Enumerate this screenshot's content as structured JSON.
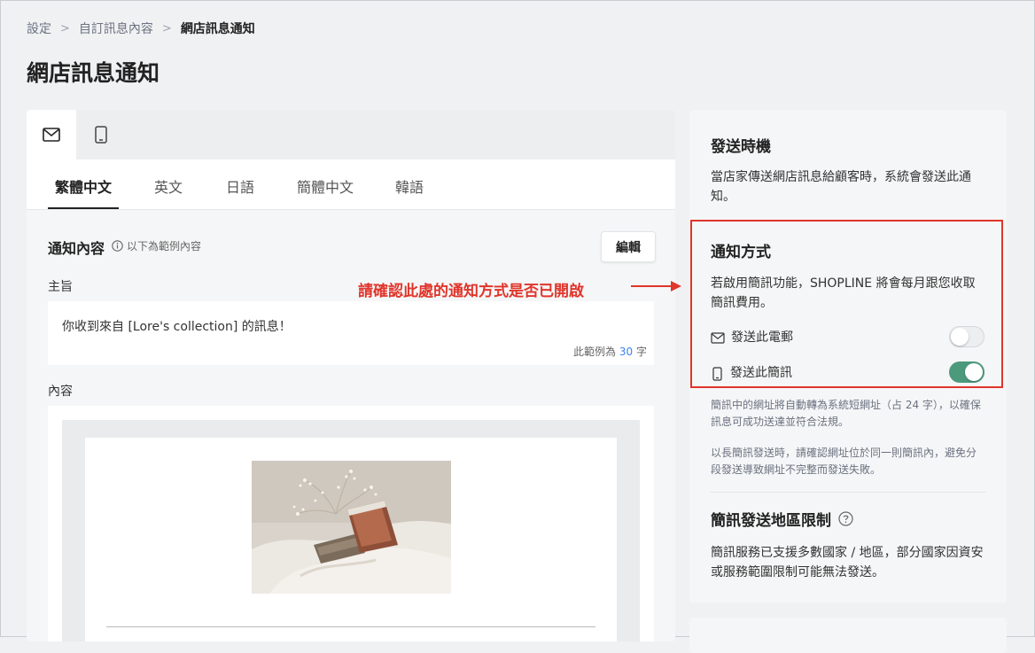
{
  "breadcrumb": {
    "items": [
      "設定",
      "自訂訊息內容"
    ],
    "current": "網店訊息通知"
  },
  "page_title": "網店訊息通知",
  "channel_tabs": [
    {
      "icon": "mail-icon",
      "active": true
    },
    {
      "icon": "mobile-icon",
      "active": false
    }
  ],
  "language_tabs": [
    {
      "label": "繁體中文",
      "active": true
    },
    {
      "label": "英文",
      "active": false
    },
    {
      "label": "日語",
      "active": false
    },
    {
      "label": "簡體中文",
      "active": false
    },
    {
      "label": "韓語",
      "active": false
    }
  ],
  "notification_content": {
    "title": "通知內容",
    "hint": "以下為範例內容",
    "edit_label": "編輯",
    "subject_label": "主旨",
    "subject_text": "你收到來自 [Lore's collection] 的訊息！",
    "char_count_prefix": "此範例為",
    "char_count_value": "30",
    "char_count_suffix": "字",
    "body_label": "內容"
  },
  "annotation": {
    "text": "請確認此處的通知方式是否已開啟",
    "color": "#e0352b"
  },
  "send_timing": {
    "title": "發送時機",
    "description_line1": "當店家傳送網店訊息給顧客時，系統會發送此通",
    "description_line2": "知。"
  },
  "notification_method": {
    "title": "通知方式",
    "description_line1": "若啟用簡訊功能，SHOPLINE 將會每月跟您收取",
    "description_line2": "簡訊費用。",
    "email_label": "發送此電郵",
    "email_enabled": false,
    "sms_label": "發送此簡訊",
    "sms_enabled": true,
    "note1_line1": "簡訊中的網址將自動轉為系統短網址（占 24 字），以確保",
    "note1_line2": "訊息可成功送達並符合法規。",
    "note2_line1": "以長簡訊發送時，請確認網址位於同一則簡訊內，避免分",
    "note2_line2": "段發送導致網址不完整而發送失敗。"
  },
  "sms_region": {
    "title": "簡訊發送地區限制",
    "description_line1": "簡訊服務已支援多數國家 / 地區，部分國家因資安",
    "description_line2": "或服務範圍限制可能無法發送。"
  },
  "colors": {
    "toggle_on": "#4c9a7c",
    "highlight": "#e0352b",
    "link_number": "#3b82f6"
  }
}
